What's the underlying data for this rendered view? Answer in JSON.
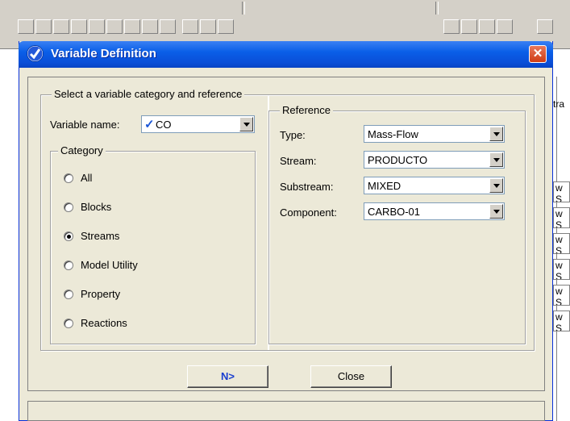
{
  "dialog": {
    "title": "Variable Definition",
    "close_glyph": "✕"
  },
  "main_group": {
    "label": "Select a variable category and reference"
  },
  "variable_name": {
    "label": "Variable name:",
    "check_glyph": "✓",
    "value": "CO"
  },
  "category": {
    "label": "Category",
    "options": [
      "All",
      "Blocks",
      "Streams",
      "Model Utility",
      "Property",
      "Reactions"
    ],
    "selected": "Streams"
  },
  "reference": {
    "label": "Reference",
    "fields": [
      {
        "label": "Type:",
        "value": "Mass-Flow"
      },
      {
        "label": "Stream:",
        "value": "PRODUCTO"
      },
      {
        "label": "Substream:",
        "value": "MIXED"
      },
      {
        "label": "Component:",
        "value": "CARBO-01"
      }
    ]
  },
  "buttons": {
    "next_label": "N>",
    "close_label": "Close"
  },
  "background": {
    "partial_header": "tra",
    "partial_cells": [
      "w S",
      "w S",
      "w S",
      "w S",
      "w S",
      "w S"
    ]
  },
  "colors": {
    "titlebar": "#0a5fe8",
    "close_button": "#d03d15",
    "dialog_face": "#ece9d8",
    "check": "#1a56d6",
    "next_button_text": "#1a3fd0"
  },
  "icons": {
    "title_icon": "check-circle-icon",
    "close_icon": "close-icon",
    "combo_arrow": "chevron-down-icon"
  }
}
